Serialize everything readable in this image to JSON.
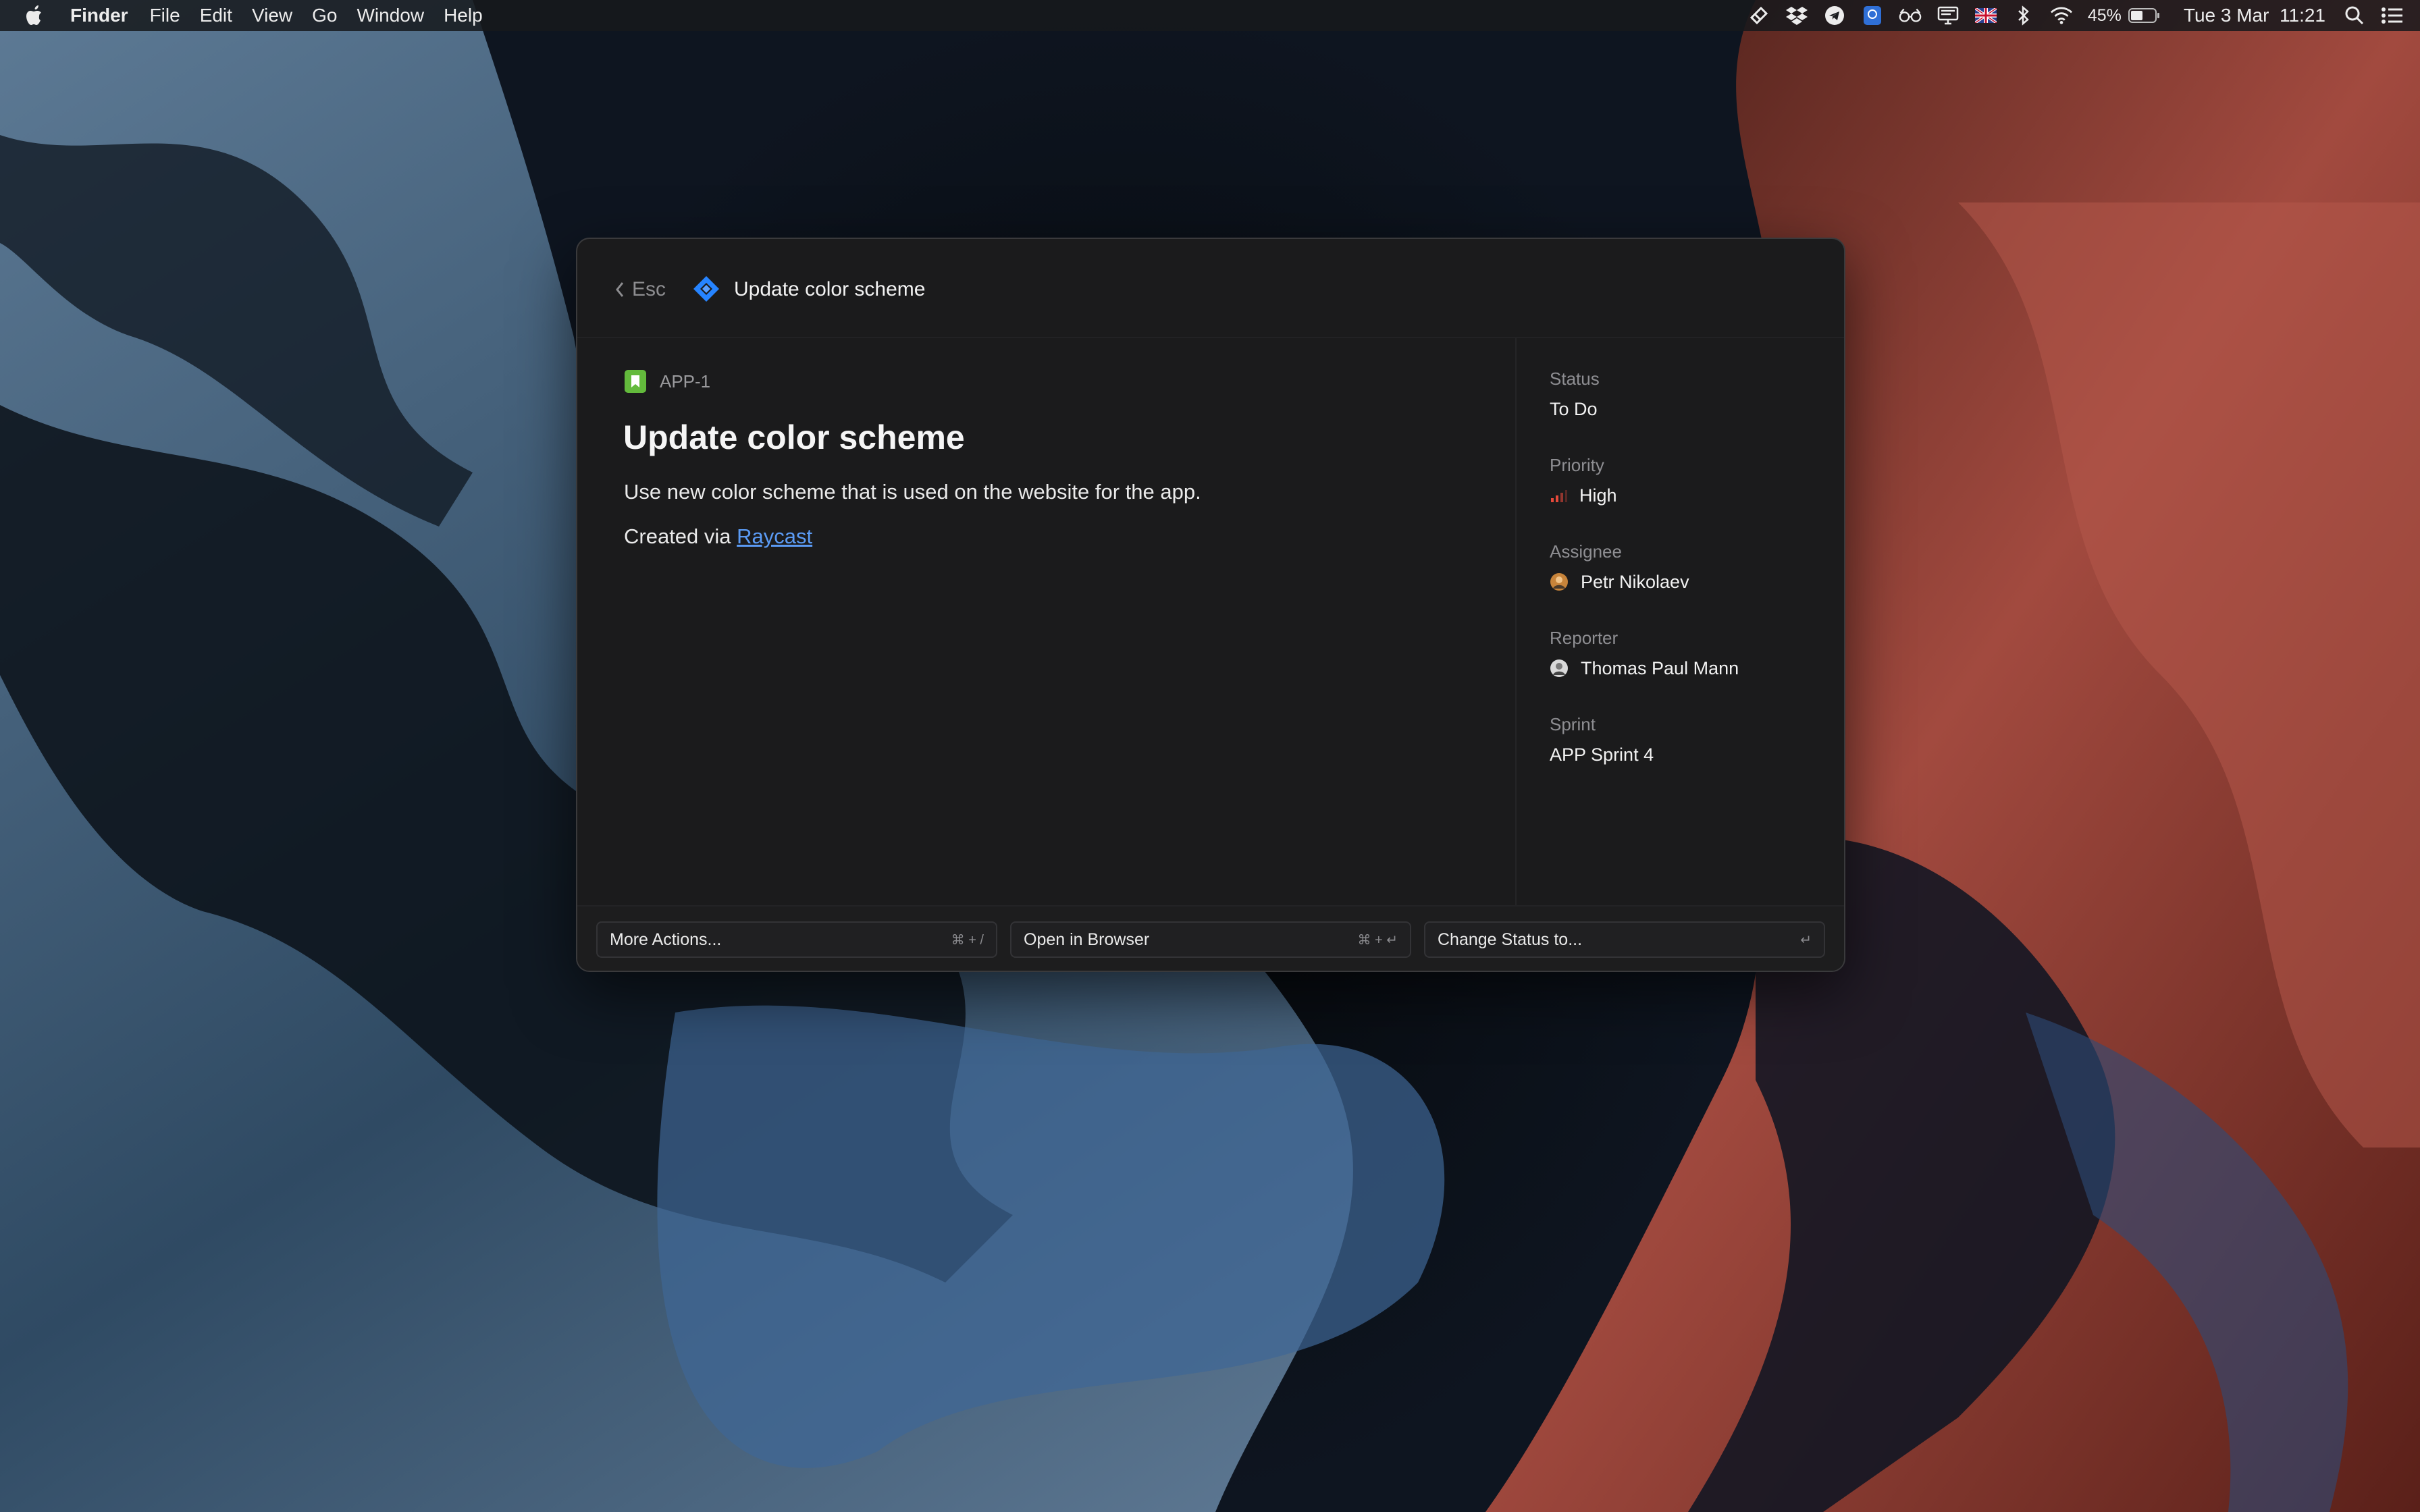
{
  "menubar": {
    "app_name": "Finder",
    "menus": [
      "File",
      "Edit",
      "View",
      "Go",
      "Window",
      "Help"
    ],
    "battery_percent": "45%",
    "datetime": "Tue 3 Mar  11:21"
  },
  "window": {
    "back_label": "Esc",
    "header_title": "Update color scheme",
    "issue": {
      "key": "APP-1",
      "title": "Update color scheme",
      "description": "Use new color scheme that is used on the website for the app.",
      "created_via_prefix": "Created via",
      "created_via_link": "Raycast"
    },
    "fields": {
      "status": {
        "label": "Status",
        "value": "To Do"
      },
      "priority": {
        "label": "Priority",
        "value": "High"
      },
      "assignee": {
        "label": "Assignee",
        "value": "Petr Nikolaev"
      },
      "reporter": {
        "label": "Reporter",
        "value": "Thomas Paul Mann"
      },
      "sprint": {
        "label": "Sprint",
        "value": "APP Sprint 4"
      }
    },
    "actions": [
      {
        "label": "More Actions...",
        "shortcut": "⌘ + /"
      },
      {
        "label": "Open in Browser",
        "shortcut": "⌘ + ↵"
      },
      {
        "label": "Change Status to...",
        "shortcut": "↵"
      }
    ]
  },
  "colors": {
    "accent_link": "#5b9bf4",
    "jira_blue": "#2684ff",
    "story_green": "#63ba3c",
    "priority_red": "#e5493a"
  },
  "icons": [
    "apple-icon",
    "back-chevron-icon",
    "jira-icon",
    "story-icon",
    "priority-high-icon",
    "avatar",
    "search-icon",
    "wifi-icon",
    "bluetooth-icon",
    "battery-icon",
    "control-center-icon"
  ]
}
